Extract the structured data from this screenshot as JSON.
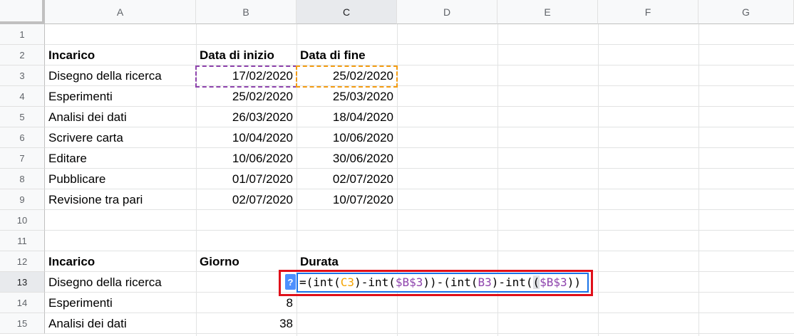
{
  "columns": [
    "A",
    "B",
    "C",
    "D",
    "E",
    "F",
    "G"
  ],
  "selected_column": "C",
  "rows": [
    "1",
    "2",
    "3",
    "4",
    "5",
    "6",
    "7",
    "8",
    "9",
    "10",
    "11",
    "12",
    "13",
    "14",
    "15"
  ],
  "selected_row": "13",
  "table1": {
    "headers": {
      "task": "Incarico",
      "start": "Data di inizio",
      "end": "Data di fine"
    },
    "rows": [
      {
        "task": "Disegno della ricerca",
        "start": "17/02/2020",
        "end": "25/02/2020"
      },
      {
        "task": "Esperimenti",
        "start": "25/02/2020",
        "end": "25/03/2020"
      },
      {
        "task": "Analisi dei dati",
        "start": "26/03/2020",
        "end": "18/04/2020"
      },
      {
        "task": "Scrivere carta",
        "start": "10/04/2020",
        "end": "10/06/2020"
      },
      {
        "task": "Editare",
        "start": "10/06/2020",
        "end": "30/06/2020"
      },
      {
        "task": "Pubblicare",
        "start": "01/07/2020",
        "end": "02/07/2020"
      },
      {
        "task": "Revisione tra pari",
        "start": "02/07/2020",
        "end": "10/07/2020"
      }
    ]
  },
  "table2": {
    "headers": {
      "task": "Incarico",
      "day": "Giorno",
      "duration": "Durata"
    },
    "rows": [
      {
        "task": "Disegno della ricerca",
        "day": ""
      },
      {
        "task": "Esperimenti",
        "day": "8"
      },
      {
        "task": "Analisi dei dati",
        "day": "38"
      }
    ]
  },
  "formula_editor": {
    "help_badge": "?",
    "tokens": [
      {
        "text": "=(int(",
        "type": "plain"
      },
      {
        "text": "C3",
        "type": "ref1"
      },
      {
        "text": ")-int(",
        "type": "plain"
      },
      {
        "text": "$B$3",
        "type": "ref2"
      },
      {
        "text": "))-(int(",
        "type": "plain"
      },
      {
        "text": "B3",
        "type": "ref2"
      },
      {
        "text": ")-int(",
        "type": "plain"
      },
      {
        "text": "(",
        "type": "paren"
      },
      {
        "text": "$B$3",
        "type": "ref3"
      },
      {
        "text": "))",
        "type": "plain"
      }
    ]
  },
  "colors": {
    "ref_c3": "#f4a300",
    "ref_b3": "#8e44ad",
    "highlight_box": "#e0101a",
    "editor_border": "#1a73e8"
  }
}
